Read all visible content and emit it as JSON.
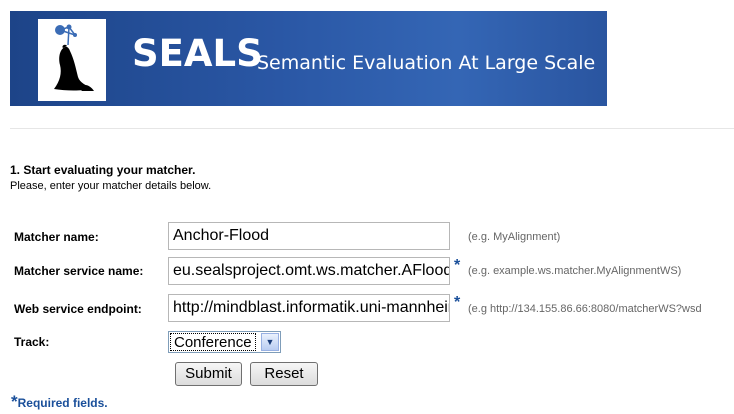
{
  "header": {
    "brand": "SEALS",
    "tagline": "Semantic Evaluation At Large Scale",
    "logo": "seals-logo-icon"
  },
  "section": {
    "title": "1. Start evaluating your matcher.",
    "subtitle": "Please, enter your matcher details below."
  },
  "form": {
    "matcher_name": {
      "label": "Matcher name:",
      "value": "Anchor-Flood",
      "hint": "(e.g. MyAlignment)"
    },
    "service_name": {
      "label": "Matcher service name:",
      "value": "eu.sealsproject.omt.ws.matcher.AFlood",
      "required_mark": "*",
      "hint": "(e.g. example.ws.matcher.MyAlignmentWS)"
    },
    "endpoint": {
      "label": "Web service endpoint:",
      "value": "http://mindblast.informatik.uni-mannheim",
      "required_mark": "*",
      "hint": "(e.g http://134.155.86.66:8080/matcherWS?wsd"
    },
    "track": {
      "label": "Track:",
      "selected": "Conference"
    },
    "submit_label": "Submit",
    "reset_label": "Reset",
    "required_star": "*",
    "required_note": "Required fields."
  },
  "colors": {
    "banner": "#2a57a5",
    "required": "#1a4f9a"
  }
}
